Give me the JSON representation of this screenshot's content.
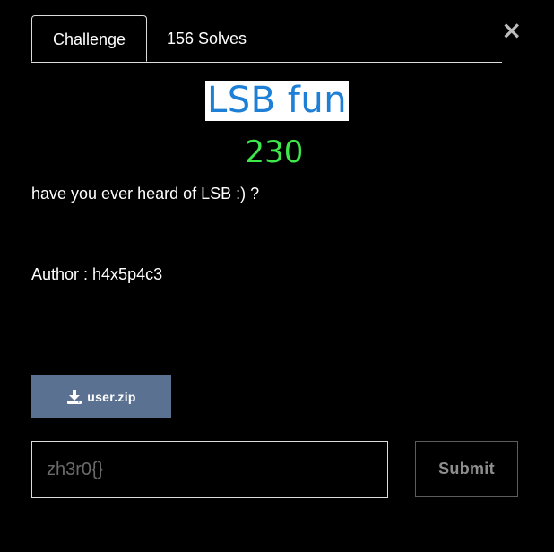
{
  "tabs": [
    {
      "label": "Challenge",
      "active": true
    },
    {
      "label": "156 Solves",
      "active": false
    }
  ],
  "close": {
    "icon": "close-icon",
    "glyph": "×"
  },
  "challenge": {
    "title": "LSB fun",
    "points": "230",
    "description": "have you ever heard of LSB :) ?",
    "author": "Author : h4x5p4c3"
  },
  "file": {
    "icon": "download-icon",
    "label": "user.zip"
  },
  "flag": {
    "placeholder": "zh3r0{}",
    "value": ""
  },
  "submit": {
    "label": "Submit"
  },
  "colors": {
    "background": "#000000",
    "title_bg": "#ffffff",
    "title_text": "#1e7fd6",
    "points": "#3ee84a",
    "file_button": "#5b7191",
    "submit_text": "#8e8e8e"
  }
}
